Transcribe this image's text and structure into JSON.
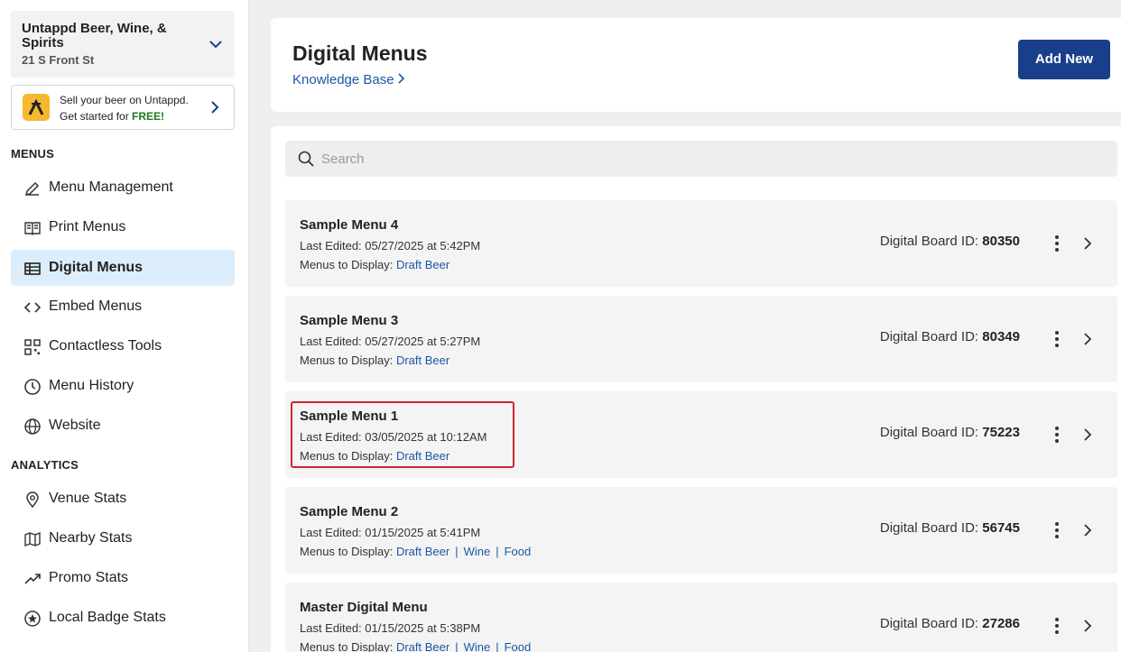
{
  "venue": {
    "name": "Untappd Beer, Wine, & Spirits",
    "address": "21 S Front St"
  },
  "promo": {
    "line1": "Sell your beer on Untappd.",
    "line2_prefix": "Get started for ",
    "line2_emphasis": "FREE!"
  },
  "sidebar": {
    "menus_title": "MENUS",
    "menus": [
      {
        "label": "Menu Management",
        "icon": "pencil-icon"
      },
      {
        "label": "Print Menus",
        "icon": "book-icon"
      },
      {
        "label": "Digital Menus",
        "icon": "table-icon",
        "active": true
      },
      {
        "label": "Embed Menus",
        "icon": "code-icon"
      },
      {
        "label": "Contactless Tools",
        "icon": "qr-code-icon"
      },
      {
        "label": "Menu History",
        "icon": "clock-icon"
      },
      {
        "label": "Website",
        "icon": "globe-icon"
      }
    ],
    "analytics_title": "ANALYTICS",
    "analytics": [
      {
        "label": "Venue Stats",
        "icon": "location-pin-icon"
      },
      {
        "label": "Nearby Stats",
        "icon": "map-icon"
      },
      {
        "label": "Promo Stats",
        "icon": "trend-up-icon"
      },
      {
        "label": "Local Badge Stats",
        "icon": "star-badge-icon"
      }
    ]
  },
  "header": {
    "title": "Digital Menus",
    "kb_link": "Knowledge Base",
    "add_button": "Add New"
  },
  "search": {
    "placeholder": "Search",
    "value": ""
  },
  "labels": {
    "last_edited": "Last Edited: ",
    "menus_to_display": "Menus to Display: ",
    "board_id": "Digital Board ID: "
  },
  "menus": [
    {
      "name": "Sample Menu 4",
      "last_edited": "05/27/2025 at 5:42PM",
      "displays": [
        "Draft Beer"
      ],
      "board_id": "80350"
    },
    {
      "name": "Sample Menu 3",
      "last_edited": "05/27/2025 at 5:27PM",
      "displays": [
        "Draft Beer"
      ],
      "board_id": "80349"
    },
    {
      "name": "Sample Menu 1",
      "last_edited": "03/05/2025 at 10:12AM",
      "displays": [
        "Draft Beer"
      ],
      "board_id": "75223"
    },
    {
      "name": "Sample Menu 2",
      "last_edited": "01/15/2025 at 5:41PM",
      "displays": [
        "Draft Beer",
        "Wine",
        "Food"
      ],
      "board_id": "56745"
    },
    {
      "name": "Master Digital Menu",
      "last_edited": "01/15/2025 at 5:38PM",
      "displays": [
        "Draft Beer",
        "Wine",
        "Food"
      ],
      "board_id": "27286"
    }
  ],
  "colors": {
    "primary": "#1a3f8a",
    "link": "#1c57a5",
    "active_bg": "#dceefb",
    "highlight": "#d0262b",
    "promo_logo": "#f5b82e"
  }
}
